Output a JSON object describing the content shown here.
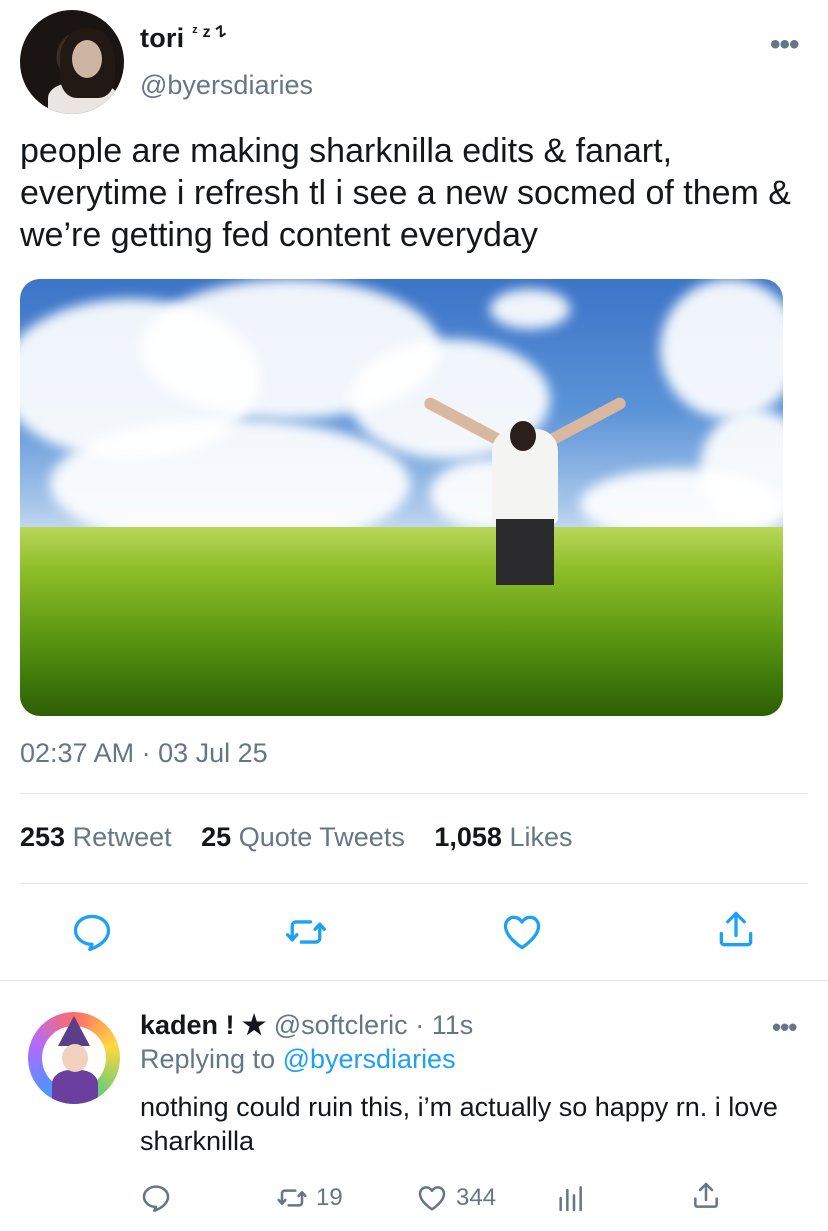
{
  "tweet": {
    "display_name": "tori",
    "display_name_suffix": "ᶻ z 𐰁",
    "handle": "@byersdiaries",
    "text": "people are making sharknilla edits & fanart, everytime i refresh tl i see a new socmed of them & we’re getting fed content everyday",
    "timestamp": "02:37 AM · 03 Jul 25",
    "more_icon": "more-horizontal-icon"
  },
  "stats": {
    "retweets_count": "253",
    "retweets_label": "Retweet",
    "quotes_count": "25",
    "quotes_label": "Quote Tweets",
    "likes_count": "1,058",
    "likes_label": "Likes"
  },
  "actions": {
    "reply_icon": "reply-icon",
    "retweet_icon": "retweet-icon",
    "like_icon": "heart-icon",
    "share_icon": "share-icon"
  },
  "reply": {
    "display_name": "kaden ! ★",
    "handle": "@softcleric",
    "time": "· 11s",
    "replying_prefix": "Replying to",
    "replying_to": "@byersdiaries",
    "text": "nothing could ruin this, i’m actually so happy rn. i love sharknilla",
    "retweet_count": "19",
    "like_count": "344"
  },
  "colors": {
    "text_primary": "#14171a",
    "text_secondary": "#657786",
    "link": "#1da1f2",
    "divider": "#e1e8ed"
  }
}
